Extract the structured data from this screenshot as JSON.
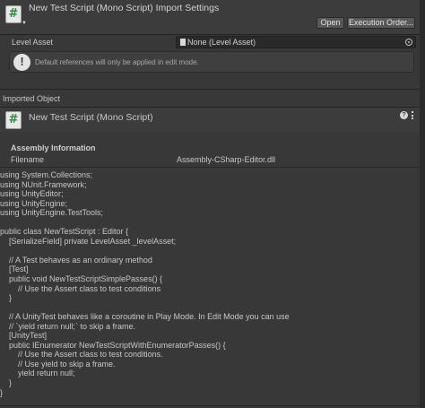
{
  "header": {
    "title": "New Test Script (Mono Script) Import Settings",
    "icon": "csharp-script-icon",
    "open_label": "Open",
    "execution_order_label": "Execution Order..."
  },
  "level_asset": {
    "label": "Level Asset",
    "value": "None (Level Asset)"
  },
  "helpbox": {
    "text": "Default references will only be applied in edit mode."
  },
  "imported_object": {
    "section_label": "Imported Object",
    "title": "New Test Script (Mono Script)",
    "help_icon_glyph": "?",
    "assembly": {
      "title": "Assembly Information",
      "filename_label": "Filename",
      "filename_value": "Assembly-CSharp-Editor.dll"
    }
  },
  "code_lines": [
    "using System.Collections;",
    "using NUnit.Framework;",
    "using UnityEditor;",
    "using UnityEngine;",
    "using UnityEngine.TestTools;",
    "",
    "public class NewTestScript : Editor {",
    "    [SerializeField] private LevelAsset _levelAsset;",
    "",
    "    // A Test behaves as an ordinary method",
    "    [Test]",
    "    public void NewTestScriptSimplePasses() {",
    "        // Use the Assert class to test conditions",
    "    }",
    "",
    "    // A UnityTest behaves like a coroutine in Play Mode. In Edit Mode you can use",
    "    // `yield return null;` to skip a frame.",
    "    [UnityTest]",
    "    public IEnumerator NewTestScriptWithEnumeratorPasses() {",
    "        // Use the Assert class to test conditions.",
    "        // Use yield to skip a frame.",
    "        yield return null;",
    "    }",
    "}"
  ]
}
